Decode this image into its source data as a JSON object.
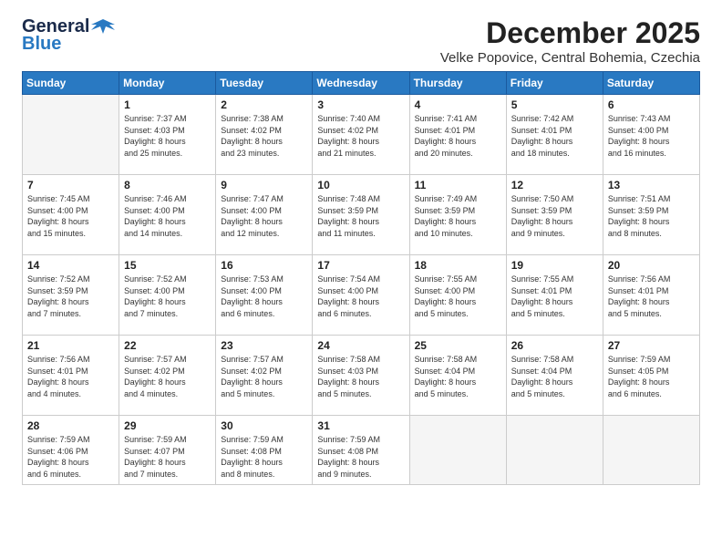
{
  "logo": {
    "text_general": "General",
    "text_blue": "Blue"
  },
  "header": {
    "month_title": "December 2025",
    "subtitle": "Velke Popovice, Central Bohemia, Czechia"
  },
  "weekdays": [
    "Sunday",
    "Monday",
    "Tuesday",
    "Wednesday",
    "Thursday",
    "Friday",
    "Saturday"
  ],
  "weeks": [
    [
      {
        "day": "",
        "info": ""
      },
      {
        "day": "1",
        "info": "Sunrise: 7:37 AM\nSunset: 4:03 PM\nDaylight: 8 hours\nand 25 minutes."
      },
      {
        "day": "2",
        "info": "Sunrise: 7:38 AM\nSunset: 4:02 PM\nDaylight: 8 hours\nand 23 minutes."
      },
      {
        "day": "3",
        "info": "Sunrise: 7:40 AM\nSunset: 4:02 PM\nDaylight: 8 hours\nand 21 minutes."
      },
      {
        "day": "4",
        "info": "Sunrise: 7:41 AM\nSunset: 4:01 PM\nDaylight: 8 hours\nand 20 minutes."
      },
      {
        "day": "5",
        "info": "Sunrise: 7:42 AM\nSunset: 4:01 PM\nDaylight: 8 hours\nand 18 minutes."
      },
      {
        "day": "6",
        "info": "Sunrise: 7:43 AM\nSunset: 4:00 PM\nDaylight: 8 hours\nand 16 minutes."
      }
    ],
    [
      {
        "day": "7",
        "info": "Sunrise: 7:45 AM\nSunset: 4:00 PM\nDaylight: 8 hours\nand 15 minutes."
      },
      {
        "day": "8",
        "info": "Sunrise: 7:46 AM\nSunset: 4:00 PM\nDaylight: 8 hours\nand 14 minutes."
      },
      {
        "day": "9",
        "info": "Sunrise: 7:47 AM\nSunset: 4:00 PM\nDaylight: 8 hours\nand 12 minutes."
      },
      {
        "day": "10",
        "info": "Sunrise: 7:48 AM\nSunset: 3:59 PM\nDaylight: 8 hours\nand 11 minutes."
      },
      {
        "day": "11",
        "info": "Sunrise: 7:49 AM\nSunset: 3:59 PM\nDaylight: 8 hours\nand 10 minutes."
      },
      {
        "day": "12",
        "info": "Sunrise: 7:50 AM\nSunset: 3:59 PM\nDaylight: 8 hours\nand 9 minutes."
      },
      {
        "day": "13",
        "info": "Sunrise: 7:51 AM\nSunset: 3:59 PM\nDaylight: 8 hours\nand 8 minutes."
      }
    ],
    [
      {
        "day": "14",
        "info": "Sunrise: 7:52 AM\nSunset: 3:59 PM\nDaylight: 8 hours\nand 7 minutes."
      },
      {
        "day": "15",
        "info": "Sunrise: 7:52 AM\nSunset: 4:00 PM\nDaylight: 8 hours\nand 7 minutes."
      },
      {
        "day": "16",
        "info": "Sunrise: 7:53 AM\nSunset: 4:00 PM\nDaylight: 8 hours\nand 6 minutes."
      },
      {
        "day": "17",
        "info": "Sunrise: 7:54 AM\nSunset: 4:00 PM\nDaylight: 8 hours\nand 6 minutes."
      },
      {
        "day": "18",
        "info": "Sunrise: 7:55 AM\nSunset: 4:00 PM\nDaylight: 8 hours\nand 5 minutes."
      },
      {
        "day": "19",
        "info": "Sunrise: 7:55 AM\nSunset: 4:01 PM\nDaylight: 8 hours\nand 5 minutes."
      },
      {
        "day": "20",
        "info": "Sunrise: 7:56 AM\nSunset: 4:01 PM\nDaylight: 8 hours\nand 5 minutes."
      }
    ],
    [
      {
        "day": "21",
        "info": "Sunrise: 7:56 AM\nSunset: 4:01 PM\nDaylight: 8 hours\nand 4 minutes."
      },
      {
        "day": "22",
        "info": "Sunrise: 7:57 AM\nSunset: 4:02 PM\nDaylight: 8 hours\nand 4 minutes."
      },
      {
        "day": "23",
        "info": "Sunrise: 7:57 AM\nSunset: 4:02 PM\nDaylight: 8 hours\nand 5 minutes."
      },
      {
        "day": "24",
        "info": "Sunrise: 7:58 AM\nSunset: 4:03 PM\nDaylight: 8 hours\nand 5 minutes."
      },
      {
        "day": "25",
        "info": "Sunrise: 7:58 AM\nSunset: 4:04 PM\nDaylight: 8 hours\nand 5 minutes."
      },
      {
        "day": "26",
        "info": "Sunrise: 7:58 AM\nSunset: 4:04 PM\nDaylight: 8 hours\nand 5 minutes."
      },
      {
        "day": "27",
        "info": "Sunrise: 7:59 AM\nSunset: 4:05 PM\nDaylight: 8 hours\nand 6 minutes."
      }
    ],
    [
      {
        "day": "28",
        "info": "Sunrise: 7:59 AM\nSunset: 4:06 PM\nDaylight: 8 hours\nand 6 minutes."
      },
      {
        "day": "29",
        "info": "Sunrise: 7:59 AM\nSunset: 4:07 PM\nDaylight: 8 hours\nand 7 minutes."
      },
      {
        "day": "30",
        "info": "Sunrise: 7:59 AM\nSunset: 4:08 PM\nDaylight: 8 hours\nand 8 minutes."
      },
      {
        "day": "31",
        "info": "Sunrise: 7:59 AM\nSunset: 4:08 PM\nDaylight: 8 hours\nand 9 minutes."
      },
      {
        "day": "",
        "info": ""
      },
      {
        "day": "",
        "info": ""
      },
      {
        "day": "",
        "info": ""
      }
    ]
  ]
}
